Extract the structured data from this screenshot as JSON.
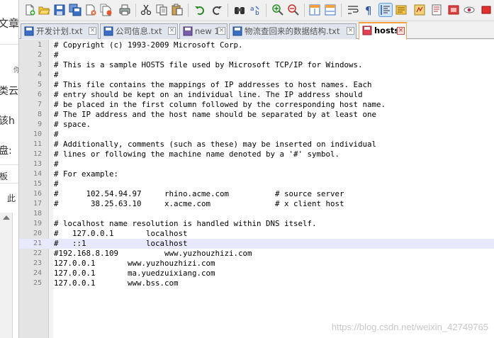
{
  "left_panel": {
    "fragments": [
      "文章",
      "你",
      "类云",
      "该h",
      "盘:",
      "板",
      "此"
    ]
  },
  "toolbar": {
    "buttons": [
      {
        "name": "new-file-button",
        "icon": "new-file-icon"
      },
      {
        "name": "open-file-button",
        "icon": "folder-open-icon"
      },
      {
        "name": "save-button",
        "icon": "save-icon"
      },
      {
        "name": "save-all-button",
        "icon": "save-all-icon"
      },
      {
        "name": "close-button",
        "icon": "close-file-icon"
      },
      {
        "name": "close-all-button",
        "icon": "close-all-icon"
      },
      {
        "name": "print-button",
        "icon": "print-icon"
      },
      {
        "name": "cut-button",
        "icon": "cut-icon"
      },
      {
        "name": "copy-button",
        "icon": "copy-icon"
      },
      {
        "name": "paste-button",
        "icon": "paste-icon"
      },
      {
        "name": "undo-button",
        "icon": "undo-icon"
      },
      {
        "name": "redo-button",
        "icon": "redo-icon"
      },
      {
        "name": "find-button",
        "icon": "binoculars-icon"
      },
      {
        "name": "replace-button",
        "icon": "replace-icon"
      },
      {
        "name": "zoom-in-button",
        "icon": "zoom-in-icon"
      },
      {
        "name": "zoom-out-button",
        "icon": "zoom-out-icon"
      },
      {
        "name": "sync-vertical-button",
        "icon": "sync-vertical-icon"
      },
      {
        "name": "sync-horizontal-button",
        "icon": "sync-horizontal-icon"
      },
      {
        "name": "word-wrap-button",
        "icon": "word-wrap-icon"
      },
      {
        "name": "show-all-chars-button",
        "icon": "pilcrow-icon"
      },
      {
        "name": "indent-guide-button",
        "icon": "indent-guide-icon"
      },
      {
        "name": "doc-map-button",
        "icon": "document-map-icon"
      },
      {
        "name": "function-list-button",
        "icon": "function-list-icon"
      },
      {
        "name": "folder-workspace-button",
        "icon": "folder-workspace-icon"
      },
      {
        "name": "record-macro-button",
        "icon": "record-icon"
      },
      {
        "name": "monitor-button",
        "icon": "eye-icon"
      },
      {
        "name": "stop-button",
        "icon": "stop-icon"
      }
    ]
  },
  "tabs": [
    {
      "label": "开发计划.txt",
      "active": false,
      "icon": "saved-file-icon"
    },
    {
      "label": "公司信息.txt",
      "active": false,
      "icon": "saved-file-icon"
    },
    {
      "label": "new 1",
      "active": false,
      "icon": "unsaved-file-icon"
    },
    {
      "label": "物流查回来的数据结构.txt",
      "active": false,
      "icon": "saved-file-icon"
    },
    {
      "label": "hosts",
      "active": true,
      "icon": "modified-file-icon"
    }
  ],
  "editor": {
    "current_line": 21,
    "lines": [
      {
        "num": "1",
        "text": "# Copyright (c) 1993-2009 Microsoft Corp."
      },
      {
        "num": "2",
        "text": "#"
      },
      {
        "num": "3",
        "text": "# This is a sample HOSTS file used by Microsoft TCP/IP for Windows."
      },
      {
        "num": "4",
        "text": "#"
      },
      {
        "num": "5",
        "text": "# This file contains the mappings of IP addresses to host names. Each"
      },
      {
        "num": "6",
        "text": "# entry should be kept on an individual line. The IP address should"
      },
      {
        "num": "7",
        "text": "# be placed in the first column followed by the corresponding host name."
      },
      {
        "num": "8",
        "text": "# The IP address and the host name should be separated by at least one"
      },
      {
        "num": "9",
        "text": "# space."
      },
      {
        "num": "10",
        "text": "#"
      },
      {
        "num": "11",
        "text": "# Additionally, comments (such as these) may be inserted on individual"
      },
      {
        "num": "12",
        "text": "# lines or following the machine name denoted by a '#' symbol."
      },
      {
        "num": "13",
        "text": "#"
      },
      {
        "num": "14",
        "text": "# For example:"
      },
      {
        "num": "15",
        "text": "#"
      },
      {
        "num": "16",
        "text": "#      102.54.94.97     rhino.acme.com          # source server"
      },
      {
        "num": "17",
        "text": "#       38.25.63.10     x.acme.com              # x client host"
      },
      {
        "num": "18",
        "text": ""
      },
      {
        "num": "19",
        "text": "# localhost name resolution is handled within DNS itself."
      },
      {
        "num": "20",
        "text": "#   127.0.0.1       localhost"
      },
      {
        "num": "21",
        "text": "#   ::1             localhost"
      },
      {
        "num": "22",
        "text": "#192.168.8.109          www.yuzhouzhizi.com"
      },
      {
        "num": "23",
        "text": "127.0.0.1       www.yuzhouzhizi.com"
      },
      {
        "num": "24",
        "text": "127.0.0.1       ma.yuedzuixiang.com"
      },
      {
        "num": "25",
        "text": "127.0.0.1       www.bss.com"
      }
    ]
  },
  "watermark": "https://blog.csdn.net/weixin_42749765"
}
